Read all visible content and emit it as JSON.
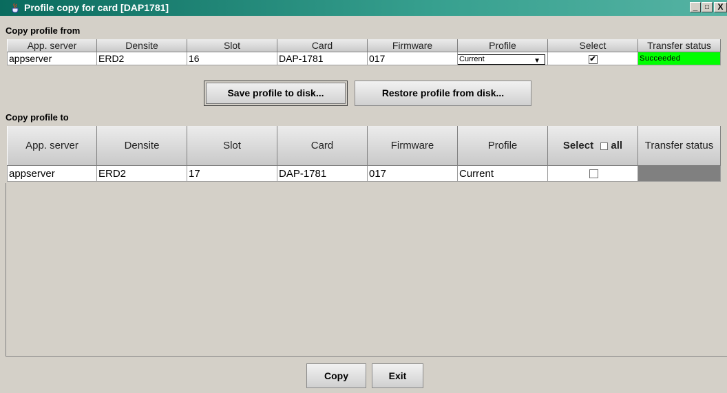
{
  "window": {
    "title": "Profile copy for card [DAP1781]",
    "controls": [
      "_",
      "□",
      "X"
    ]
  },
  "from_section": {
    "label": "Copy profile from",
    "columns": [
      "App. server",
      "Densite",
      "Slot",
      "Card",
      "Firmware",
      "Profile",
      "Select",
      "Transfer status"
    ],
    "row": {
      "app_server": "appserver",
      "densite": "ERD2",
      "slot": "16",
      "card": "DAP-1781",
      "firmware": "017",
      "profile": "Current",
      "selected": true,
      "transfer_status": "Succeeded"
    }
  },
  "disk_buttons": {
    "save": "Save profile to disk...",
    "restore": "Restore profile from disk..."
  },
  "to_section": {
    "label": "Copy profile to",
    "columns": [
      "App. server",
      "Densite",
      "Slot",
      "Card",
      "Firmware",
      "Profile",
      "Select",
      "all",
      "Transfer status"
    ],
    "row": {
      "app_server": "appserver",
      "densite": "ERD2",
      "slot": "17",
      "card": "DAP-1781",
      "firmware": "017",
      "profile": "Current",
      "selected": false,
      "transfer_status": ""
    }
  },
  "footer": {
    "copy": "Copy",
    "exit": "Exit"
  },
  "colors": {
    "title_bar": "#0a6b5e",
    "status_succeeded": "#00ff00",
    "status_pending": "#808080",
    "selected_cell": "#dcdcf8"
  },
  "icons": [
    "java-cup-icon",
    "minimize-icon",
    "maximize-icon",
    "close-icon",
    "dropdown-arrow-icon",
    "checkbox-icon"
  ]
}
